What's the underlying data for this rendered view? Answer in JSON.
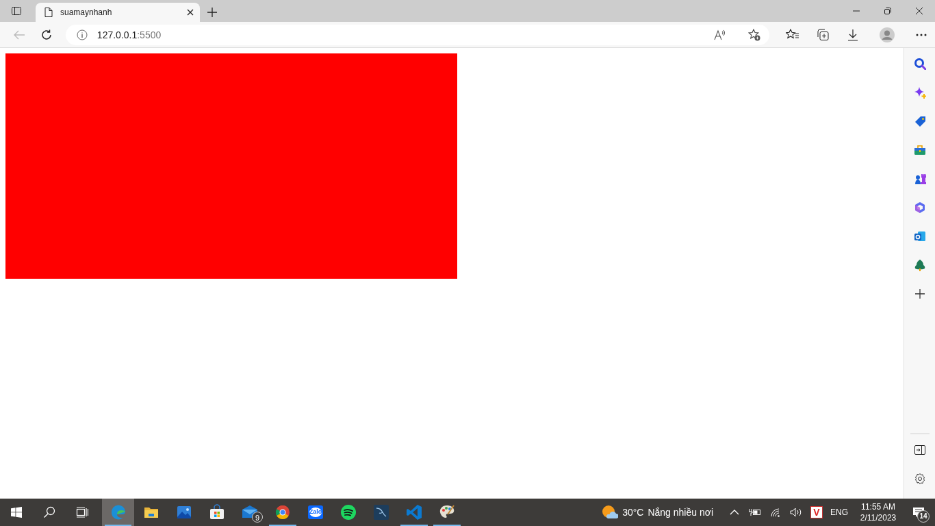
{
  "browser": {
    "tab": {
      "title": "suamaynhanh",
      "selected": true
    },
    "address": {
      "host": "127.0.0.1",
      "port": ":5500"
    }
  },
  "sidebar": {
    "items": [
      {
        "kind": "search"
      },
      {
        "kind": "sparkle"
      },
      {
        "kind": "tag"
      },
      {
        "kind": "toolbox"
      },
      {
        "kind": "games"
      },
      {
        "kind": "office"
      },
      {
        "kind": "outlook"
      },
      {
        "kind": "tree"
      },
      {
        "kind": "add"
      }
    ]
  },
  "taskbar": {
    "apps": [
      {
        "kind": "edge",
        "running": true,
        "selected": true
      },
      {
        "kind": "explorer",
        "running": false,
        "selected": false
      },
      {
        "kind": "photos",
        "running": false,
        "selected": false
      },
      {
        "kind": "store",
        "running": false,
        "selected": false
      },
      {
        "kind": "mail",
        "running": false,
        "selected": false,
        "badge": "9"
      },
      {
        "kind": "chrome",
        "running": true,
        "selected": false
      },
      {
        "kind": "zalo",
        "running": false,
        "selected": false,
        "label": "Zalo"
      },
      {
        "kind": "spotify",
        "running": false,
        "selected": false
      },
      {
        "kind": "mysql",
        "running": false,
        "selected": false
      },
      {
        "kind": "vscode",
        "running": true,
        "selected": false
      },
      {
        "kind": "paint",
        "running": true,
        "selected": false
      }
    ],
    "weather": {
      "temperature": "30°C",
      "condition": "Nắng nhiều nơi"
    },
    "tray_app_letter": "V",
    "language": "ENG",
    "time": "11:55 AM",
    "date": "2/11/2023",
    "notifications": "14"
  }
}
